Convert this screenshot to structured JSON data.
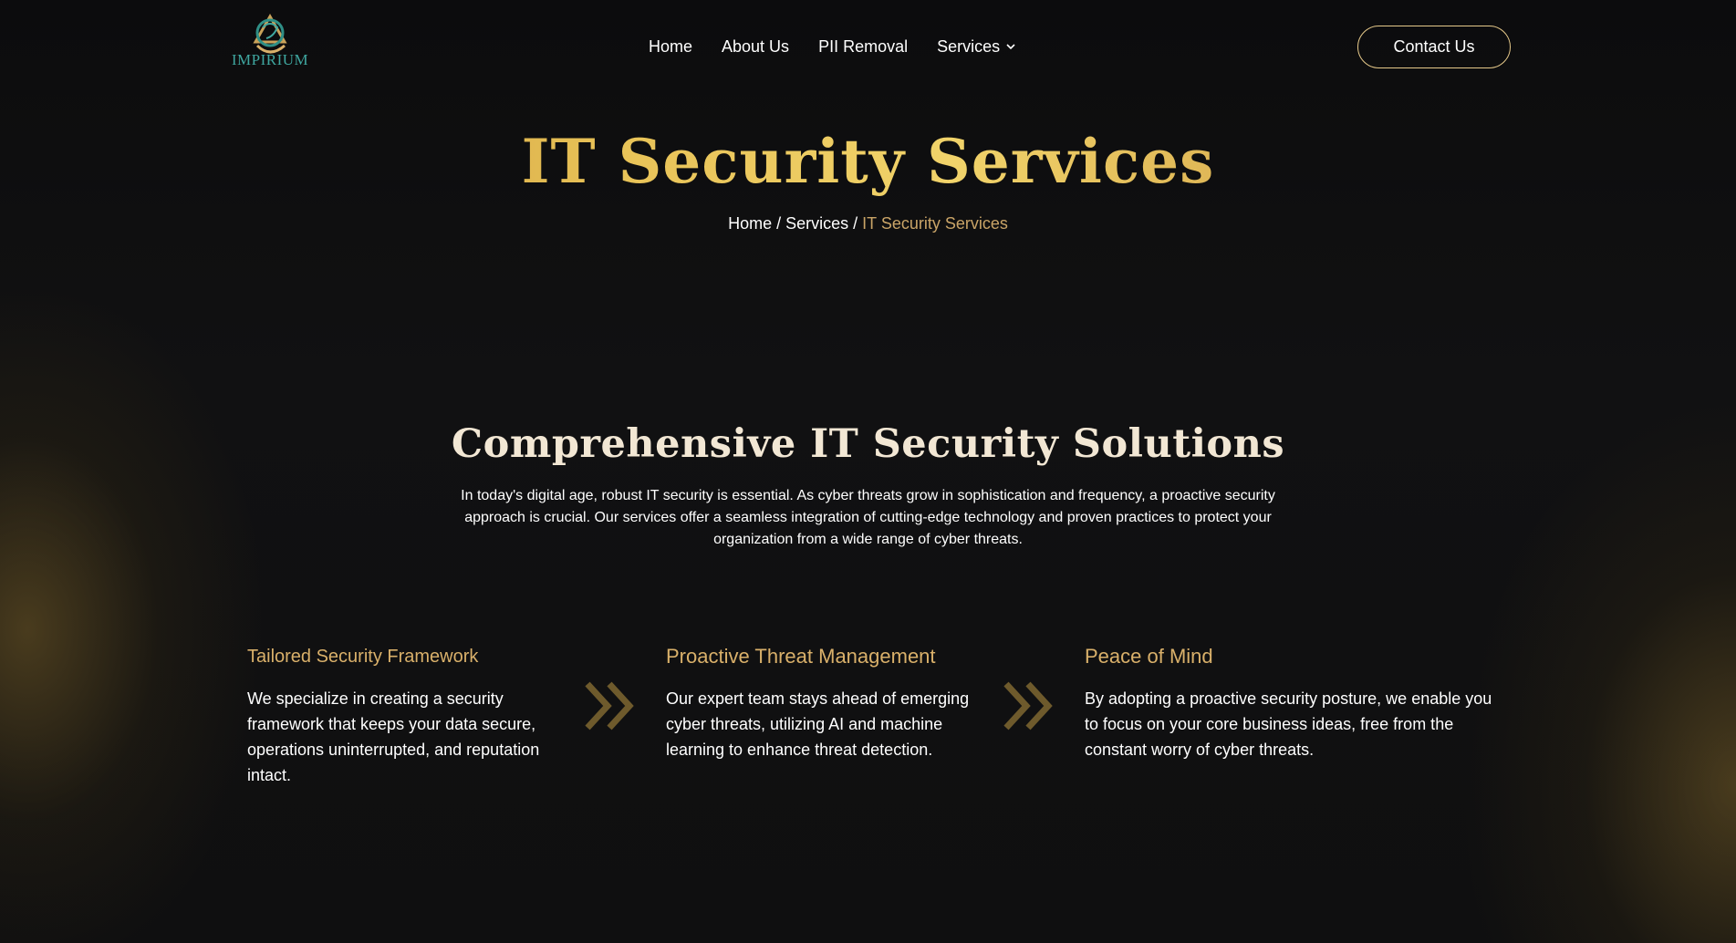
{
  "brand": {
    "name": "IMPIRIUM",
    "logo_icon": "impirium-logo-emblem"
  },
  "nav": {
    "items": [
      {
        "label": "Home"
      },
      {
        "label": "About Us"
      },
      {
        "label": "PII Removal"
      },
      {
        "label": "Services"
      }
    ],
    "dropdown_icon": "chevron-down-icon"
  },
  "contact_button": {
    "label": "Contact Us"
  },
  "hero": {
    "title": "IT Security Services",
    "breadcrumb": {
      "home": "Home",
      "services": "Services",
      "current": "IT Security Services",
      "separator": "/"
    }
  },
  "section": {
    "title": "Comprehensive IT Security Solutions",
    "description": "In today's digital age, robust IT security is essential. As cyber threats grow in sophistication and frequency, a proactive security approach is crucial. Our services offer a seamless integration of cutting-edge technology and proven practices to protect your organization from a wide range of cyber threats."
  },
  "features": [
    {
      "title": "Tailored Security Framework",
      "text": "We specialize in creating a security framework that keeps your data secure, operations uninterrupted, and reputation intact."
    },
    {
      "title": "Proactive Threat Management",
      "text": "Our expert team stays ahead of emerging cyber threats, utilizing AI and machine learning to enhance threat detection."
    },
    {
      "title": "Peace of Mind",
      "text": "By adopting a proactive security posture, we enable you to focus on your core business ideas, free from the constant worry of cyber threats."
    }
  ],
  "colors": {
    "background": "#0e0e0f",
    "gold_accent": "#d9b06a",
    "breadcrumb_current": "#c9a467",
    "button_border": "#e6c98a",
    "section_title": "#f2e7d4",
    "arrow": "#6e5a2c"
  }
}
